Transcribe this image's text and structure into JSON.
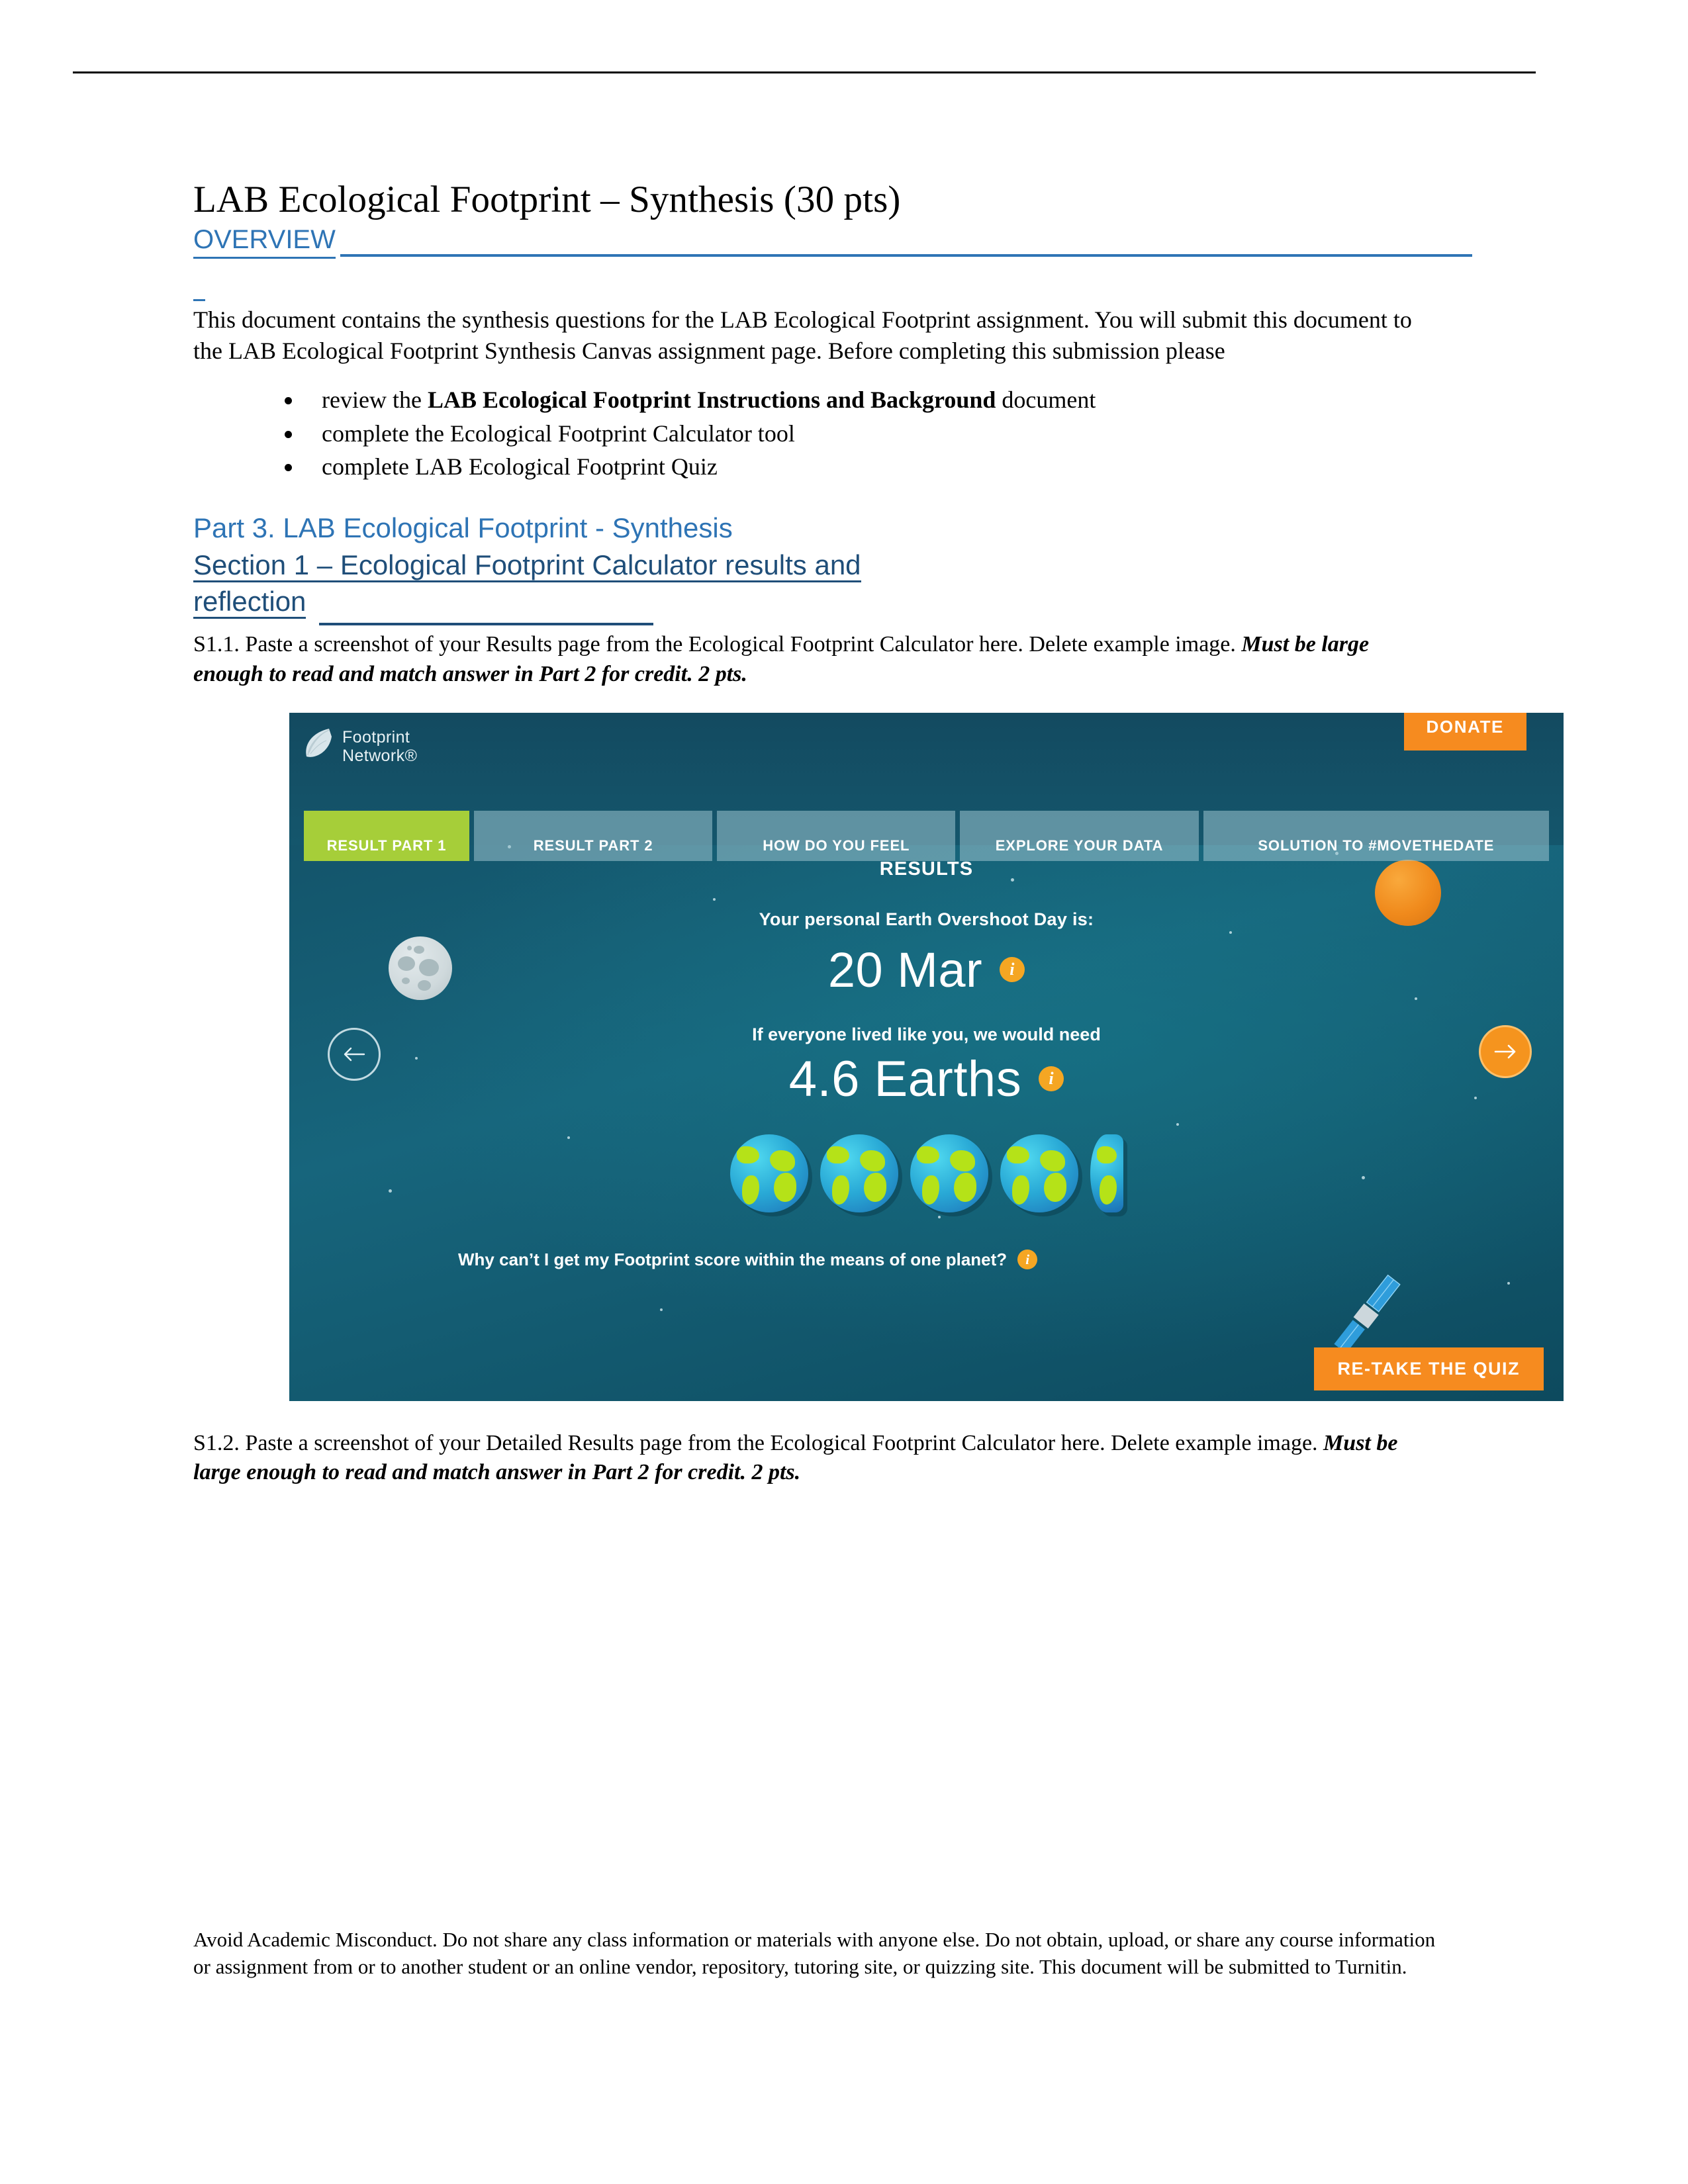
{
  "document": {
    "title": "LAB Ecological Footprint – Synthesis (30 pts)",
    "overview_heading": "OVERVIEW",
    "intro_paragraph": "This document contains the synthesis questions for the LAB Ecological Footprint assignment. You will submit this document to the LAB Ecological Footprint Synthesis Canvas assignment page. Before completing this submission please",
    "bullets": [
      {
        "lead": "review the ",
        "bold": "LAB Ecological Footprint Instructions and Background",
        "tail": " document"
      },
      {
        "lead": "complete the Ecological Footprint Calculator tool",
        "bold": "",
        "tail": ""
      },
      {
        "lead": "complete LAB Ecological Footprint Quiz",
        "bold": "",
        "tail": ""
      }
    ],
    "part_heading": "Part 3. LAB Ecological Footprint - Synthesis",
    "section_heading_line1": "Section 1 – Ecological Footprint Calculator results and",
    "section_heading_line2": "reflection",
    "q1_1_plain": "S1.1. Paste a screenshot of your Results page from the Ecological Footprint Calculator here. Delete example image. ",
    "q1_1_emphasis": "Must be large enough to read and match answer in Part 2 for credit. 2 pts.",
    "q1_2_plain": "S1.2. Paste a screenshot of your Detailed Results page from the Ecological Footprint Calculator here. Delete example image. ",
    "q1_2_emphasis": "Must be large enough to read and match answer in Part 2 for credit. 2 pts.",
    "footer_note": "Avoid Academic Misconduct. Do not share any class information or materials with anyone else. Do not obtain, upload, or share any course information or assignment from or to another student or an online vendor, repository, tutoring site, or quizzing site. This document will be submitted to Turnitin."
  },
  "colors": {
    "heading_blue": "#2E74B5",
    "section_blue": "#1F4E79",
    "accent_orange": "#F68B1F",
    "accent_green": "#A6CE39",
    "space_teal": "#14566C"
  },
  "screenshot": {
    "brand": {
      "logo_line1": "Footprint",
      "logo_line2": "Network®",
      "donate_label": "DONATE"
    },
    "tabs": [
      {
        "label": "RESULT PART 1",
        "active": true
      },
      {
        "label": "RESULT PART 2",
        "active": false
      },
      {
        "label": "HOW DO YOU FEEL",
        "active": false
      },
      {
        "label": "EXPLORE YOUR DATA",
        "active": false
      },
      {
        "label": "SOLUTION TO #MOVETHEDATE",
        "active": false
      }
    ],
    "results_label": "RESULTS",
    "overshoot_label": "Your personal Earth Overshoot Day is:",
    "overshoot_date": "20 Mar",
    "lived_label": "If everyone lived like you, we would need",
    "earths_value": "4.6 Earths",
    "earths_count": 4.6,
    "why_question": "Why can’t I get my Footprint score within the means of one planet?",
    "retake_label": "RE-TAKE THE QUIZ",
    "info_icon": "info-icon",
    "prev_icon": "arrow-left-icon",
    "next_icon": "arrow-right-icon"
  }
}
